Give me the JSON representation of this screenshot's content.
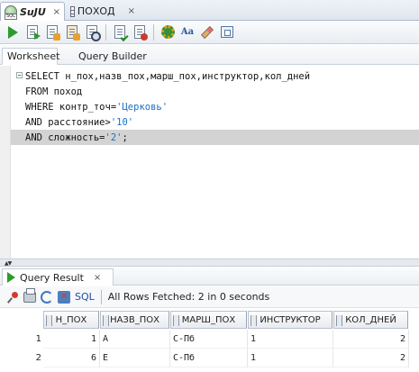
{
  "doc_tabs": [
    {
      "label": "SuJU",
      "close": "×"
    },
    {
      "label": "ПОХОД",
      "close": "×"
    }
  ],
  "toolbar_icons": [
    "run-statement-icon",
    "run-script-icon",
    "commit-icon",
    "rollback-icon",
    "autotrace-icon",
    "explain-plan-icon",
    "clear-icon",
    "sql-tuning-icon",
    "change-case-icon",
    "eraser-icon",
    "history-icon"
  ],
  "sub_tabs": {
    "worksheet": "Worksheet",
    "query_builder": "Query Builder"
  },
  "editor": {
    "lines": [
      [
        {
          "t": "SELECT н_пох,назв_пох,марш_пох,инструктор,кол_дней",
          "c": "kw"
        }
      ],
      [
        {
          "t": "FROM поход",
          "c": "kw"
        }
      ],
      [
        {
          "t": "WHERE контр_точ=",
          "c": "kw"
        },
        {
          "t": "'Церковь'",
          "c": "str"
        }
      ],
      [
        {
          "t": "AND расстояние>",
          "c": "kw"
        },
        {
          "t": "'10'",
          "c": "str"
        }
      ],
      [
        {
          "t": "AND сложность=",
          "c": "kw"
        },
        {
          "t": "'2'",
          "c": "str"
        },
        {
          "t": ";",
          "c": "kw"
        }
      ]
    ]
  },
  "results": {
    "tab_label": "Query Result",
    "tab_close": "×",
    "sql_label": "SQL",
    "status": "All Rows Fetched: 2 in 0 seconds",
    "columns": [
      "Н_ПОХ",
      "НАЗВ_ПОХ",
      "МАРШ_ПОХ",
      "ИНСТРУКТОР",
      "КОЛ_ДНЕЙ"
    ],
    "rows": [
      {
        "num": "1",
        "cells": [
          "1",
          "А",
          "С-Пб",
          "1",
          "2"
        ]
      },
      {
        "num": "2",
        "cells": [
          "6",
          "Е",
          "С-Пб",
          "1",
          "2"
        ]
      }
    ]
  }
}
